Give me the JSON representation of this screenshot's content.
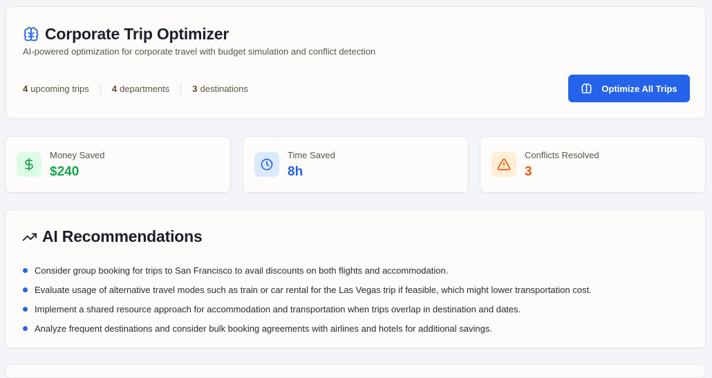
{
  "header": {
    "title": "Corporate Trip Optimizer",
    "subtitle": "AI-powered optimization for corporate travel with budget simulation and conflict detection",
    "stats": [
      {
        "count": "4",
        "label": "upcoming trips"
      },
      {
        "count": "4",
        "label": "departments"
      },
      {
        "count": "3",
        "label": "destinations"
      }
    ],
    "optimize_button_label": "Optimize All Trips",
    "icon": "brain-icon"
  },
  "metrics": [
    {
      "label": "Money Saved",
      "value": "$240",
      "icon": "dollar-icon",
      "color": "#16a34a",
      "icon_bg": "#dcfce7"
    },
    {
      "label": "Time Saved",
      "value": "8h",
      "icon": "clock-icon",
      "color": "#2563eb",
      "icon_bg": "#dbeafe"
    },
    {
      "label": "Conflicts Resolved",
      "value": "3",
      "icon": "warning-icon",
      "color": "#ea580c",
      "icon_bg": "#ffedd5"
    }
  ],
  "recommendations": {
    "title": "AI Recommendations",
    "icon": "trending-up-icon",
    "items": [
      "Consider group booking for trips to San Francisco to avail discounts on both flights and accommodation.",
      "Evaluate usage of alternative travel modes such as train or car rental for the Las Vegas trip if feasible, which might lower transportation cost.",
      "Implement a shared resource approach for accommodation and transportation when trips overlap in destination and dates.",
      "Analyze frequent destinations and consider bulk booking agreements with airlines and hotels for additional savings."
    ]
  },
  "colors": {
    "accent": "#2563eb",
    "background": "#f3f5f9",
    "card": "#fdfcfa"
  }
}
